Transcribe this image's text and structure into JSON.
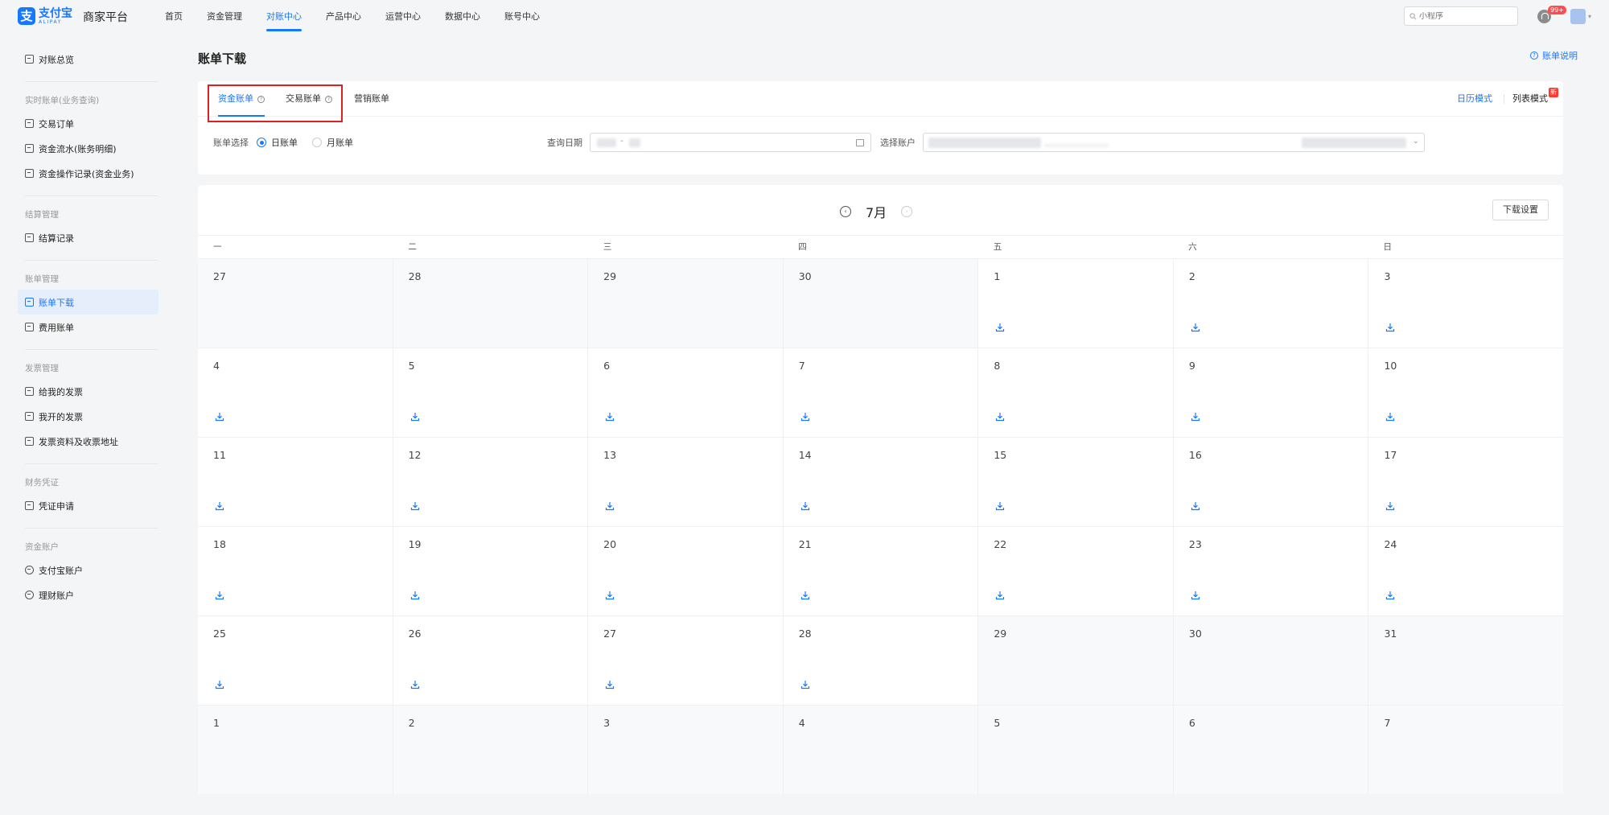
{
  "topbar": {
    "logo_cn": "支付宝",
    "logo_en": "ALIPAY",
    "platform": "商家平台",
    "nav": [
      "首页",
      "资金管理",
      "对账中心",
      "产品中心",
      "运营中心",
      "数据中心",
      "账号中心"
    ],
    "active_nav_index": 2,
    "search_placeholder": "小程序",
    "notification_badge": "99+"
  },
  "sidebar": {
    "overview": "对账总览",
    "groups": [
      {
        "title": "实时账单(业务查询)",
        "items": [
          "交易订单",
          "资金流水(账务明细)",
          "资金操作记录(资金业务)"
        ]
      },
      {
        "title": "结算管理",
        "items": [
          "结算记录"
        ]
      },
      {
        "title": "账单管理",
        "items": [
          "账单下载",
          "费用账单"
        ]
      },
      {
        "title": "发票管理",
        "items": [
          "给我的发票",
          "我开的发票",
          "发票资料及收票地址"
        ]
      },
      {
        "title": "财务凭证",
        "items": [
          "凭证申请"
        ]
      },
      {
        "title": "资金账户",
        "items": [
          "支付宝账户",
          "理财账户"
        ]
      }
    ],
    "active_item": "账单下载"
  },
  "page": {
    "title": "账单下载",
    "help_link": "账单说明"
  },
  "filters": {
    "tabs": [
      "资金账单",
      "交易账单",
      "营销账单"
    ],
    "active_tab_index": 0,
    "calendar_mode": "日历模式",
    "list_mode": "列表模式",
    "new_badge": "新",
    "bill_select_label": "账单选择",
    "bill_options": [
      "日账单",
      "月账单"
    ],
    "bill_selected_index": 0,
    "query_date_label": "查询日期",
    "query_date_sep": "-",
    "account_label": "选择账户"
  },
  "calendar": {
    "month": "7月",
    "download_settings": "下载设置",
    "weekdays": [
      "一",
      "二",
      "三",
      "四",
      "五",
      "六",
      "日"
    ],
    "weeks": [
      [
        {
          "d": "27",
          "m": true,
          "dl": false
        },
        {
          "d": "28",
          "m": true,
          "dl": false
        },
        {
          "d": "29",
          "m": true,
          "dl": false
        },
        {
          "d": "30",
          "m": true,
          "dl": false
        },
        {
          "d": "1",
          "m": false,
          "dl": true
        },
        {
          "d": "2",
          "m": false,
          "dl": true
        },
        {
          "d": "3",
          "m": false,
          "dl": true
        }
      ],
      [
        {
          "d": "4",
          "m": false,
          "dl": true
        },
        {
          "d": "5",
          "m": false,
          "dl": true
        },
        {
          "d": "6",
          "m": false,
          "dl": true
        },
        {
          "d": "7",
          "m": false,
          "dl": true
        },
        {
          "d": "8",
          "m": false,
          "dl": true
        },
        {
          "d": "9",
          "m": false,
          "dl": true
        },
        {
          "d": "10",
          "m": false,
          "dl": true
        }
      ],
      [
        {
          "d": "11",
          "m": false,
          "dl": true
        },
        {
          "d": "12",
          "m": false,
          "dl": true
        },
        {
          "d": "13",
          "m": false,
          "dl": true
        },
        {
          "d": "14",
          "m": false,
          "dl": true
        },
        {
          "d": "15",
          "m": false,
          "dl": true
        },
        {
          "d": "16",
          "m": false,
          "dl": true
        },
        {
          "d": "17",
          "m": false,
          "dl": true
        }
      ],
      [
        {
          "d": "18",
          "m": false,
          "dl": true
        },
        {
          "d": "19",
          "m": false,
          "dl": true
        },
        {
          "d": "20",
          "m": false,
          "dl": true
        },
        {
          "d": "21",
          "m": false,
          "dl": true
        },
        {
          "d": "22",
          "m": false,
          "dl": true
        },
        {
          "d": "23",
          "m": false,
          "dl": true
        },
        {
          "d": "24",
          "m": false,
          "dl": true
        }
      ],
      [
        {
          "d": "25",
          "m": false,
          "dl": true
        },
        {
          "d": "26",
          "m": false,
          "dl": true
        },
        {
          "d": "27",
          "m": false,
          "dl": true
        },
        {
          "d": "28",
          "m": false,
          "dl": true
        },
        {
          "d": "29",
          "m": true,
          "dl": false
        },
        {
          "d": "30",
          "m": true,
          "dl": false
        },
        {
          "d": "31",
          "m": true,
          "dl": false
        }
      ],
      [
        {
          "d": "1",
          "m": true,
          "dl": false
        },
        {
          "d": "2",
          "m": true,
          "dl": false
        },
        {
          "d": "3",
          "m": true,
          "dl": false
        },
        {
          "d": "4",
          "m": true,
          "dl": false
        },
        {
          "d": "5",
          "m": true,
          "dl": false
        },
        {
          "d": "6",
          "m": true,
          "dl": false
        },
        {
          "d": "7",
          "m": true,
          "dl": false
        }
      ]
    ]
  },
  "colors": {
    "accent": "#1677ff",
    "highlight_box": "#e02020",
    "badge": "#ff4d4f"
  }
}
